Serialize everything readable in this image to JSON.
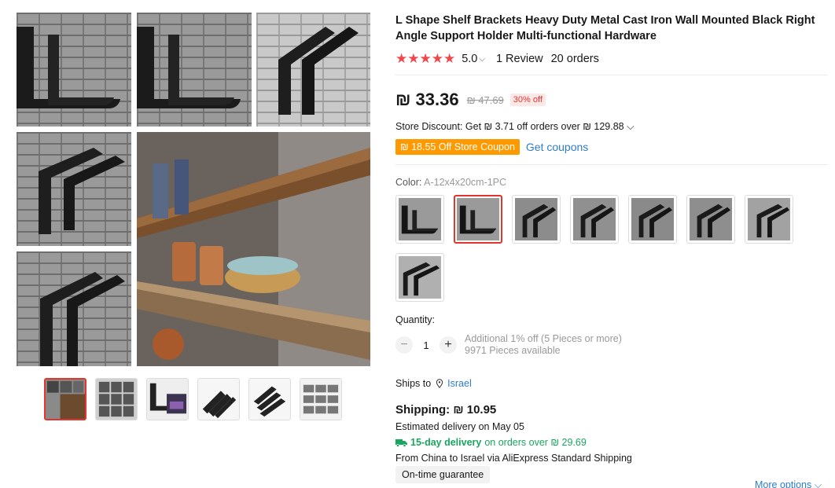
{
  "product": {
    "title": "L Shape Shelf Brackets Heavy Duty Metal Cast Iron Wall Mounted Black Right Angle Support Holder Multi-functional Hardware",
    "stars": "★★★★★",
    "rating": "5.0",
    "rating_chevron": "⌵",
    "reviews": "1 Review",
    "orders": "20 orders"
  },
  "price": {
    "current": "₪ 33.36",
    "original": "₪ 47.69",
    "discount": "30% off"
  },
  "store_discount": {
    "text": "Store Discount: Get ₪ 3.71 off orders over ₪ 129.88 ⌵"
  },
  "coupon": {
    "label": "₪ 18.55 Off Store Coupon",
    "get_coupons": "Get coupons"
  },
  "color": {
    "label": "Color:",
    "value": "A-12x4x20cm-1PC",
    "selected_index": 1,
    "swatch_count": 8
  },
  "quantity": {
    "label": "Quantity:",
    "minus": "−",
    "value": "1",
    "plus": "+",
    "note_line1": "Additional 1% off (5 Pieces or more)",
    "note_line2": "9971 Pieces available"
  },
  "shipping": {
    "ships_to_label": "Ships to",
    "country": "Israel",
    "cost": "Shipping: ₪ 10.95",
    "estimated": "Estimated delivery on May 05",
    "fast_bold": "15-day delivery",
    "fast_rest": "on orders over ₪ 29.69",
    "from": "From China to Israel via AliExpress Standard Shipping",
    "ontime": "On-time guarantee",
    "more_options": "More options ⌵"
  },
  "gallery": {
    "thumb_count": 6,
    "selected_thumb": 0
  },
  "colors": {
    "accent_red": "#e2352c",
    "star_red": "#f0474c",
    "link_blue": "#2e7dc9",
    "coupon_orange": "#ff9900",
    "delivery_green": "#1aa55e"
  },
  "icons": [
    "star-icon",
    "chevron-down-icon",
    "location-pin-icon",
    "truck-icon",
    "minus-icon",
    "plus-icon"
  ]
}
